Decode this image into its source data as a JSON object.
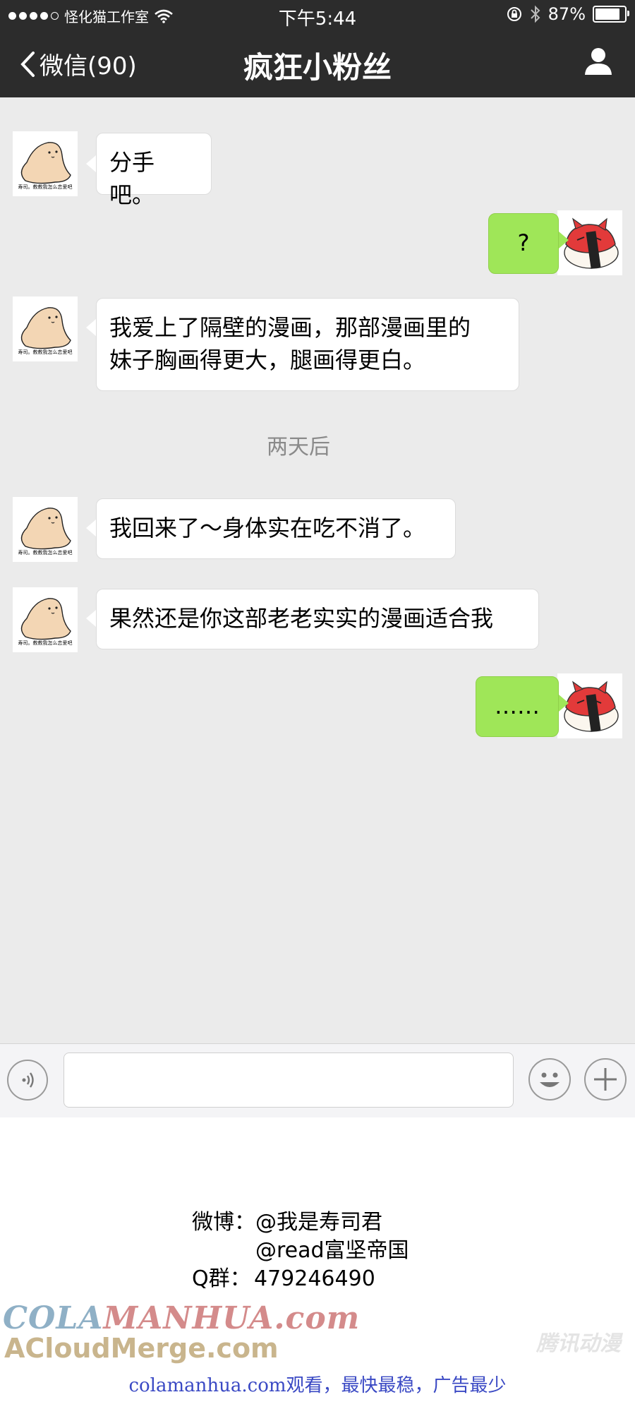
{
  "status_bar": {
    "carrier": "怪化猫工作室",
    "time": "下午5:44",
    "battery": "87%"
  },
  "nav": {
    "back_label": "微信(90)",
    "title": "疯狂小粉丝"
  },
  "avatars": {
    "sender_caption": "寿司。教教我怎么恋爱吧"
  },
  "messages": [
    {
      "side": "in",
      "text": "分手吧。"
    },
    {
      "side": "out",
      "text": "?"
    },
    {
      "side": "in",
      "lines": [
        "我爱上了隔壁的漫画，那部漫画里的",
        "妹子胸画得更大，腿画得更白。"
      ]
    },
    {
      "side": "system",
      "text": "两天后"
    },
    {
      "side": "in",
      "text": "我回来了～身体实在吃不消了。"
    },
    {
      "side": "in",
      "text": "果然还是你这部老老实实的漫画适合我"
    },
    {
      "side": "out",
      "text": "……"
    }
  ],
  "input_bar": {
    "voice_icon": "voice-icon",
    "emoji_icon": "emoji-icon",
    "plus_icon": "plus-icon"
  },
  "credits": {
    "weibo_label": "微博：",
    "weibo_1": "@我是寿司君",
    "weibo_2": "@read富坚帝国",
    "qq_label": "Q群：",
    "qq_number": "479246490"
  },
  "watermarks": {
    "cola": "COLA",
    "manhua": "MANHUA.com",
    "acloud": "ACloudMerge.com",
    "tencent": "腾讯动漫",
    "footer": "colamanhua.com观看，最快最稳，广告最少"
  },
  "colors": {
    "nav_bg": "#2c2c2c",
    "chat_bg": "#ebebeb",
    "outgoing_bubble": "#9fe658",
    "incoming_bubble": "#ffffff"
  }
}
